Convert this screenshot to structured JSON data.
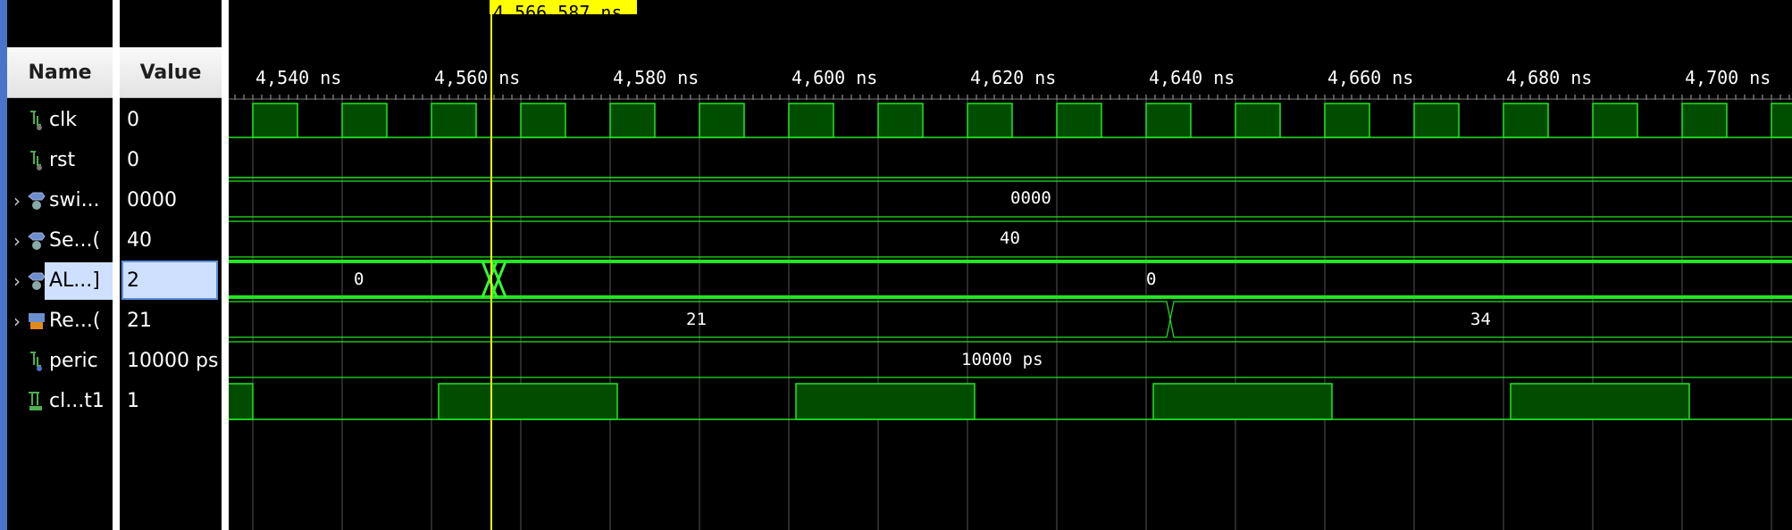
{
  "header": {
    "name_label": "Name",
    "value_label": "Value"
  },
  "cursor": {
    "label": "4,566.587 ns",
    "color": "#ffff00"
  },
  "timeline": {
    "ticks": [
      "4,540 ns",
      "4,560 ns",
      "4,580 ns",
      "4,600 ns",
      "4,620 ns",
      "4,640 ns",
      "4,660 ns",
      "4,680 ns",
      "4,700 ns"
    ]
  },
  "colors": {
    "wave": "#22e622",
    "wave_fill": "#004d00",
    "selected_value_bg": "#cfe0ff",
    "panel_border": "#4a74c9"
  },
  "signals": [
    {
      "name": "clk",
      "value": "0",
      "icon": "bit-signal-icon",
      "expandable": false
    },
    {
      "name": "rst",
      "value": "0",
      "icon": "bit-signal-icon",
      "expandable": false
    },
    {
      "name": "swi...",
      "value": "0000",
      "icon": "bus-signal-icon",
      "expandable": true,
      "bus_label": "0000"
    },
    {
      "name": "Se...(",
      "value": "40",
      "icon": "bus-signal-icon",
      "expandable": true,
      "bus_label": "40"
    },
    {
      "name": "AL...]",
      "value": "2",
      "icon": "bus-signal-icon",
      "expandable": true,
      "selected": true,
      "bus_labels": [
        "0",
        "0"
      ]
    },
    {
      "name": "Re...(",
      "value": "21",
      "icon": "memory-signal-icon",
      "expandable": true,
      "bus_labels": [
        "21",
        "34"
      ]
    },
    {
      "name": "peric",
      "value": "10000 ps",
      "icon": "parameter-icon",
      "expandable": false,
      "bus_label": "10000 ps"
    },
    {
      "name": "cl...t1",
      "value": "1",
      "icon": "bit-signal-icon",
      "expandable": false
    }
  ]
}
